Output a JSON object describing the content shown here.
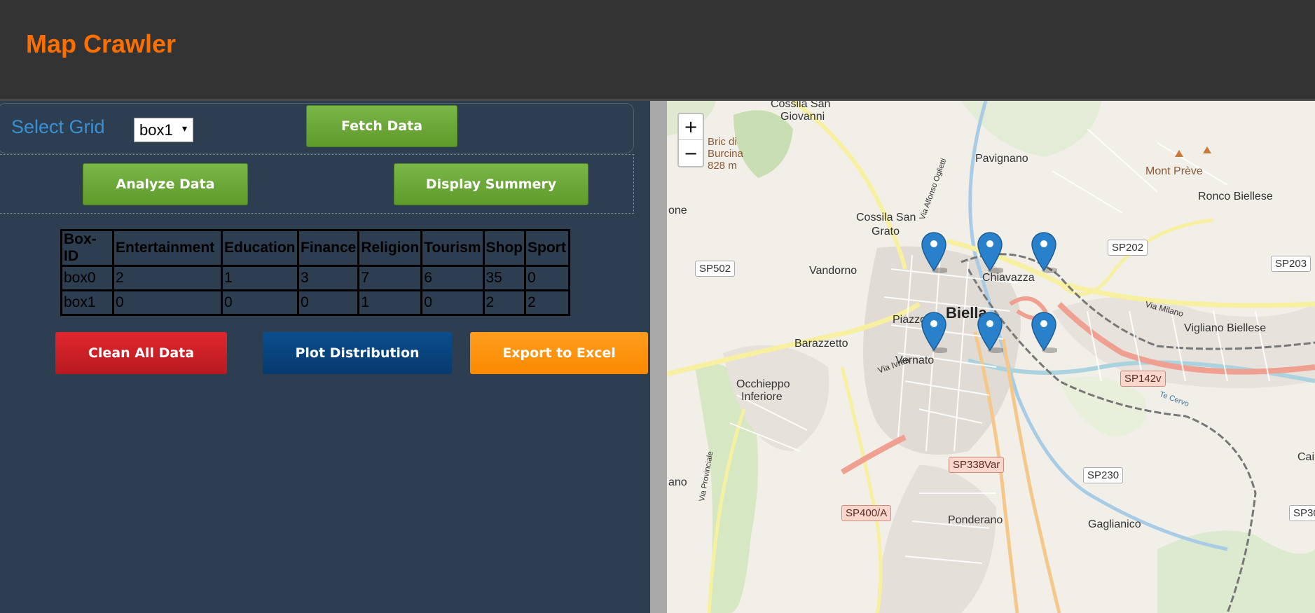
{
  "app": {
    "title": "Map Crawler"
  },
  "grid": {
    "label": "Select Grid",
    "selected": "box1",
    "caret": "▾"
  },
  "buttons": {
    "fetch": "Fetch Data",
    "analyze": "Analyze Data",
    "summary": "Display Summery",
    "clean": "Clean All Data",
    "plot": "Plot Distribution",
    "export": "Export to Excel"
  },
  "table": {
    "headers": [
      "Box-ID",
      "Entertainment",
      "Education",
      "Finance",
      "Religion",
      "Tourism",
      "Shop",
      "Sport"
    ],
    "rows": [
      [
        "box0",
        "2",
        "1",
        "3",
        "7",
        "6",
        "35",
        "0"
      ],
      [
        "box1",
        "0",
        "0",
        "0",
        "1",
        "0",
        "2",
        "2"
      ]
    ]
  },
  "map": {
    "zoom_in": "+",
    "zoom_out": "−",
    "places": {
      "cossila_san_giovanni_1": "Cossila San",
      "cossila_san_giovanni_2": "Giovanni",
      "bric_1": "Bric di",
      "bric_2": "Burcina",
      "bric_3": "828 m",
      "pavignano": "Pavignano",
      "mont_preve": "Mont Prève",
      "ronco": "Ronco Biellese",
      "cossila_grato_1": "Cossila San",
      "cossila_grato_2": "Grato",
      "vandorno": "Vandorno",
      "one": "one",
      "chiavazza": "Chiavazza",
      "biella": "Biella",
      "piazzo": "Piazzo",
      "barazzetto": "Barazzetto",
      "vernato": "Vernato",
      "vigliano": "Vigliano Biellese",
      "occhieppo_1": "Occhieppo",
      "occhieppo_2": "Inferiore",
      "ano": "ano",
      "cai": "Cai",
      "ponderano": "Ponderano",
      "gaglianico": "Gaglianico",
      "via_ivrea": "Via Ivrea",
      "via_milano": "Via Milano",
      "via_oglietti": "Via Alfonso Oglietti",
      "via_provinciale": "Via Provinciale",
      "torrente_cervo": "Te Cervo"
    },
    "roads": {
      "sp202": "SP202",
      "sp502": "SP502",
      "sp203": "SP203",
      "sp142v": "SP142v",
      "sp338var": "SP338Var",
      "sp230": "SP230",
      "sp400a": "SP400/A",
      "sp30": "SP30"
    },
    "marker_color": "#2a81cb"
  }
}
